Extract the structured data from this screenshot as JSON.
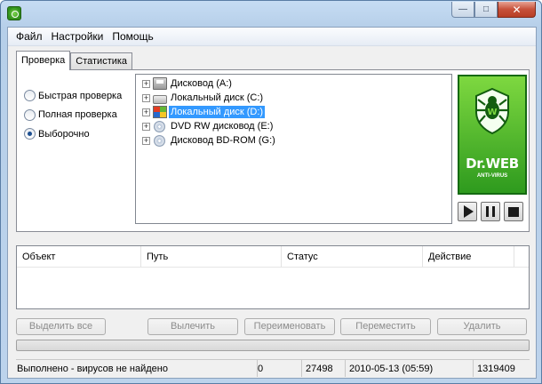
{
  "window": {
    "title": ""
  },
  "menu": [
    "Файл",
    "Настройки",
    "Помощь"
  ],
  "tabs": [
    {
      "label": "Проверка",
      "active": true
    },
    {
      "label": "Статистика",
      "active": false
    }
  ],
  "scan_modes": [
    {
      "label": "Быстрая проверка",
      "checked": false
    },
    {
      "label": "Полная проверка",
      "checked": false
    },
    {
      "label": "Выборочно",
      "checked": true
    }
  ],
  "drives": [
    {
      "label": "Дисковод (A:)",
      "icon": "floppy-icon",
      "selected": false
    },
    {
      "label": "Локальный диск (C:)",
      "icon": "hdd-icon",
      "selected": false
    },
    {
      "label": "Локальный диск (D:)",
      "icon": "windows-drive-icon",
      "selected": true
    },
    {
      "label": "DVD RW дисковод (E:)",
      "icon": "dvd-icon",
      "selected": false
    },
    {
      "label": "Дисковод BD-ROM (G:)",
      "icon": "dvd-icon",
      "selected": false
    }
  ],
  "brand": {
    "name": "Dr.WEB",
    "sub": "ANTI-VIRUS",
    "color": "#3fae27"
  },
  "controls": {
    "play": "play-icon",
    "pause": "pause-icon",
    "stop": "stop-icon"
  },
  "results": {
    "columns": [
      "Объект",
      "Путь",
      "Статус",
      "Действие"
    ],
    "rows": []
  },
  "actions": [
    "Выделить все",
    "Вылечить",
    "Переименовать",
    "Переместить",
    "Удалить"
  ],
  "progress": {
    "fraction": 0
  },
  "status": {
    "message": "Выполнено - вирусов не найдено",
    "viruses": "0",
    "files": "27498",
    "datetime": "2010-05-13 (05:59)",
    "records": "1319409"
  }
}
